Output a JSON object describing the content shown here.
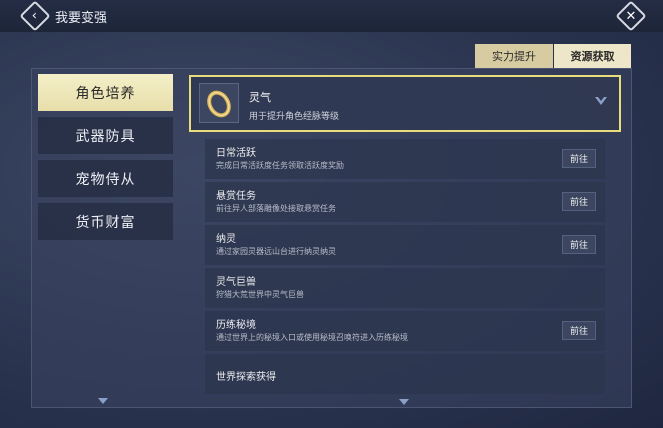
{
  "header": {
    "title": "我要变强"
  },
  "tabs": [
    {
      "label": "实力提升"
    },
    {
      "label": "资源获取",
      "active": true
    }
  ],
  "sidebar": {
    "items": [
      {
        "label": "角色培养",
        "active": true
      },
      {
        "label": "武器防具"
      },
      {
        "label": "宠物侍从"
      },
      {
        "label": "货币财富"
      }
    ]
  },
  "resource": {
    "name": "灵气",
    "description": "用于提升角色经脉等级",
    "icon": "ring-item-icon"
  },
  "sources": [
    {
      "title": "日常活跃",
      "desc": "完成日常活跃度任务领取活跃度奖励",
      "button": "前往"
    },
    {
      "title": "悬赏任务",
      "desc": "前往异人部落雕像处接取悬赏任务",
      "button": "前往"
    },
    {
      "title": "纳灵",
      "desc": "通过家园灵器远山台进行纳灵纳灵",
      "button": "前往"
    },
    {
      "title": "灵气巨兽",
      "desc": "狩猎大荒世界中灵气巨兽",
      "button": ""
    },
    {
      "title": "历练秘境",
      "desc": "通过世界上的秘境入口或使用秘境召唤符进入历练秘境",
      "button": "前往"
    },
    {
      "title": "世界探索获得",
      "desc": "",
      "button": ""
    }
  ],
  "colors": {
    "highlight_border": "#e8dc7c",
    "active_tab": "#eee6c8"
  }
}
